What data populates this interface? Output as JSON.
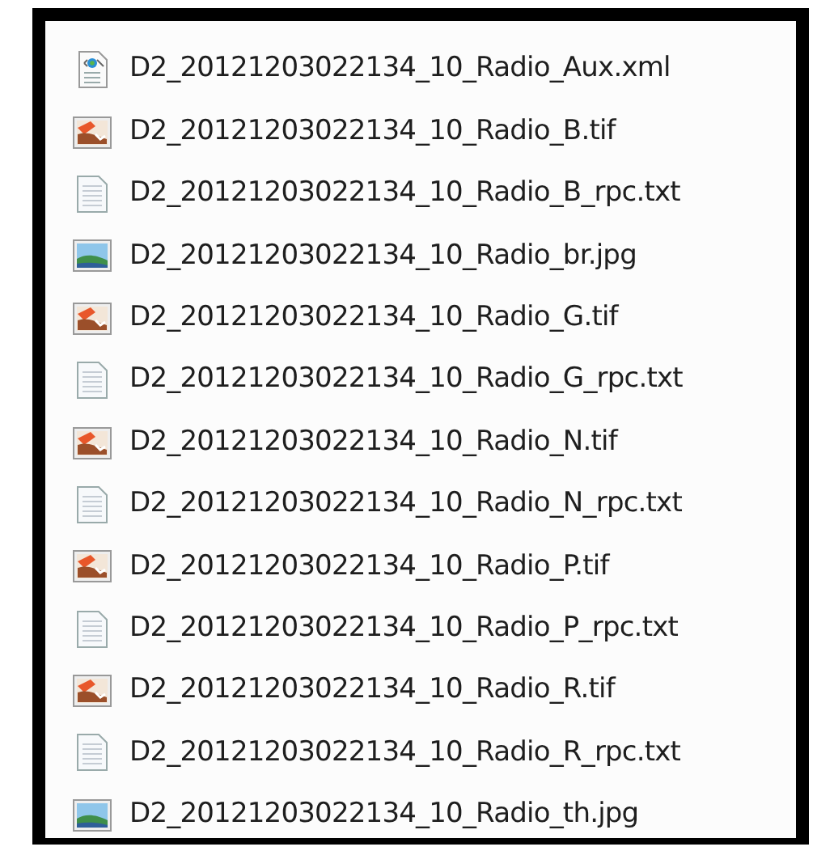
{
  "files": [
    {
      "name": "D2_20121203022134_10_Radio_Aux.xml",
      "kind": "xml"
    },
    {
      "name": "D2_20121203022134_10_Radio_B.tif",
      "kind": "tif"
    },
    {
      "name": "D2_20121203022134_10_Radio_B_rpc.txt",
      "kind": "txt"
    },
    {
      "name": "D2_20121203022134_10_Radio_br.jpg",
      "kind": "jpg"
    },
    {
      "name": "D2_20121203022134_10_Radio_G.tif",
      "kind": "tif"
    },
    {
      "name": "D2_20121203022134_10_Radio_G_rpc.txt",
      "kind": "txt"
    },
    {
      "name": "D2_20121203022134_10_Radio_N.tif",
      "kind": "tif"
    },
    {
      "name": "D2_20121203022134_10_Radio_N_rpc.txt",
      "kind": "txt"
    },
    {
      "name": "D2_20121203022134_10_Radio_P.tif",
      "kind": "tif"
    },
    {
      "name": "D2_20121203022134_10_Radio_P_rpc.txt",
      "kind": "txt"
    },
    {
      "name": "D2_20121203022134_10_Radio_R.tif",
      "kind": "tif"
    },
    {
      "name": "D2_20121203022134_10_Radio_R_rpc.txt",
      "kind": "txt"
    },
    {
      "name": "D2_20121203022134_10_Radio_th.jpg",
      "kind": "jpg"
    }
  ]
}
